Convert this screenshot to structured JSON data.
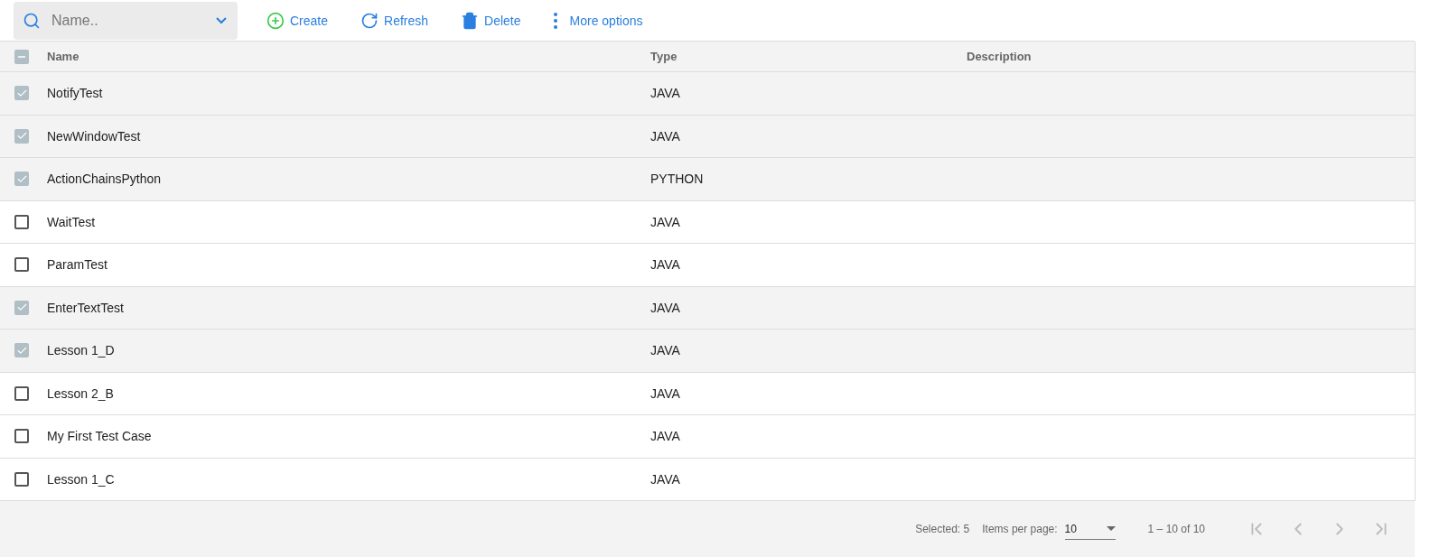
{
  "search": {
    "placeholder": "Name.."
  },
  "actions": [
    {
      "kind": "create",
      "label": "Create"
    },
    {
      "kind": "refresh",
      "label": "Refresh"
    },
    {
      "kind": "delete",
      "label": "Delete"
    },
    {
      "kind": "more",
      "label": "More options"
    }
  ],
  "table": {
    "select_all": {
      "indeterminate": true
    },
    "columns": [
      "Name",
      "Type",
      "Description"
    ],
    "rows": [
      {
        "name": "NotifyTest",
        "type": "JAVA",
        "selected": true
      },
      {
        "name": "NewWindowTest",
        "type": "JAVA",
        "selected": true
      },
      {
        "name": "ActionChainsPython",
        "type": "PYTHON",
        "selected": true
      },
      {
        "name": "WaitTest",
        "type": "JAVA",
        "selected": false
      },
      {
        "name": "ParamTest",
        "type": "JAVA",
        "selected": false
      },
      {
        "name": "EnterTextTest",
        "type": "JAVA",
        "selected": true
      },
      {
        "name": "Lesson 1_D",
        "type": "JAVA",
        "selected": true
      },
      {
        "name": "Lesson 2_B",
        "type": "JAVA",
        "selected": false
      },
      {
        "name": "My First Test Case",
        "type": "JAVA",
        "selected": false
      },
      {
        "name": "Lesson 1_C",
        "type": "JAVA",
        "selected": false
      }
    ]
  },
  "footer": {
    "selected": "Selected: 5",
    "items_per_page_label": "Items per page:",
    "items_per_page": "10",
    "range": "1 – 10 of 10"
  }
}
